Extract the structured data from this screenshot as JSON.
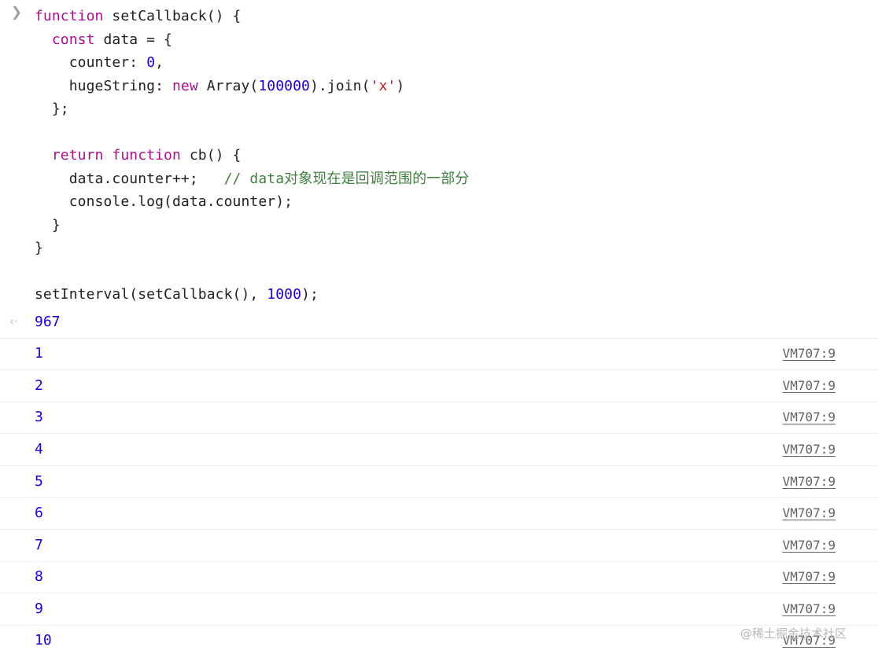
{
  "console": {
    "prompt_icon": "❯",
    "return_icon": "‹·",
    "input": {
      "lines": [
        [
          {
            "t": "function",
            "c": "kw"
          },
          {
            "t": " setCallback() {",
            "c": "plain"
          }
        ],
        [
          {
            "t": "  ",
            "c": "plain"
          },
          {
            "t": "const",
            "c": "kw"
          },
          {
            "t": " data = {",
            "c": "plain"
          }
        ],
        [
          {
            "t": "    counter: ",
            "c": "plain"
          },
          {
            "t": "0",
            "c": "num"
          },
          {
            "t": ",",
            "c": "plain"
          }
        ],
        [
          {
            "t": "    hugeString: ",
            "c": "plain"
          },
          {
            "t": "new",
            "c": "kw"
          },
          {
            "t": " Array(",
            "c": "plain"
          },
          {
            "t": "100000",
            "c": "num"
          },
          {
            "t": ").join(",
            "c": "plain"
          },
          {
            "t": "'x'",
            "c": "str"
          },
          {
            "t": ")",
            "c": "plain"
          }
        ],
        [
          {
            "t": "  };",
            "c": "plain"
          }
        ],
        [
          {
            "t": "",
            "c": "plain"
          }
        ],
        [
          {
            "t": "  ",
            "c": "plain"
          },
          {
            "t": "return function",
            "c": "kw"
          },
          {
            "t": " cb() {",
            "c": "plain"
          }
        ],
        [
          {
            "t": "    data.counter++;   ",
            "c": "plain"
          },
          {
            "t": "// data对象现在是回调范围的一部分",
            "c": "comment"
          }
        ],
        [
          {
            "t": "    console.log(data.counter);",
            "c": "plain"
          }
        ],
        [
          {
            "t": "  }",
            "c": "plain"
          }
        ],
        [
          {
            "t": "}",
            "c": "plain"
          }
        ],
        [
          {
            "t": "",
            "c": "plain"
          }
        ],
        [
          {
            "t": "setInterval(setCallback(), ",
            "c": "plain"
          },
          {
            "t": "1000",
            "c": "num"
          },
          {
            "t": ");",
            "c": "plain"
          }
        ]
      ]
    },
    "result": {
      "value": "967"
    },
    "logs": [
      {
        "message": "1",
        "source": "VM707:9"
      },
      {
        "message": "2",
        "source": "VM707:9"
      },
      {
        "message": "3",
        "source": "VM707:9"
      },
      {
        "message": "4",
        "source": "VM707:9"
      },
      {
        "message": "5",
        "source": "VM707:9"
      },
      {
        "message": "6",
        "source": "VM707:9"
      },
      {
        "message": "7",
        "source": "VM707:9"
      },
      {
        "message": "8",
        "source": "VM707:9"
      },
      {
        "message": "9",
        "source": "VM707:9"
      },
      {
        "message": "10",
        "source": "VM707:9"
      }
    ],
    "watermark": "@稀土掘金技术社区",
    "colors": {
      "keyword": "#aa0d91",
      "number": "#1c00cf",
      "string": "#b5231f",
      "comment": "#3f7f3f",
      "plain": "#202124",
      "source_link": "#5f6368",
      "row_divider": "#ededed",
      "background": "#ffffff"
    }
  }
}
